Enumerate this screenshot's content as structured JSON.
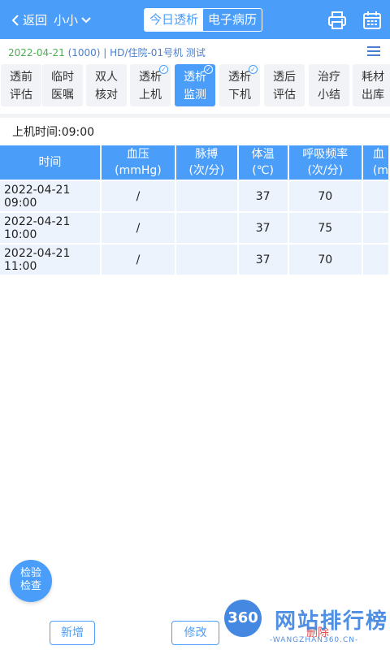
{
  "header": {
    "back_label": "返回",
    "patient_name": "小小",
    "tabs": [
      {
        "label": "今日透析",
        "active": true
      },
      {
        "label": "电子病历",
        "active": false
      }
    ],
    "icons": [
      "printer-icon",
      "calendar-icon"
    ]
  },
  "info": {
    "date": "2022-04-21",
    "rest": " (1000) | HD/住院-01号机 测试"
  },
  "steps": [
    {
      "line1": "透前",
      "line2": "评估",
      "checked": false,
      "active": false
    },
    {
      "line1": "临时",
      "line2": "医嘱",
      "checked": false,
      "active": false
    },
    {
      "line1": "双人",
      "line2": "核对",
      "checked": false,
      "active": false
    },
    {
      "line1": "透析",
      "line2": "上机",
      "checked": true,
      "active": false
    },
    {
      "line1": "透析",
      "line2": "监测",
      "checked": true,
      "active": true
    },
    {
      "line1": "透析",
      "line2": "下机",
      "checked": true,
      "active": false
    },
    {
      "line1": "透后",
      "line2": "评估",
      "checked": false,
      "active": false
    },
    {
      "line1": "治疗",
      "line2": "小结",
      "checked": false,
      "active": false
    },
    {
      "line1": "耗材",
      "line2": "出库",
      "checked": false,
      "active": false
    }
  ],
  "start_time": "上机时间:09:00",
  "table": {
    "headers": [
      {
        "line1": "时间",
        "line2": ""
      },
      {
        "line1": "血压",
        "line2": "(mmHg)"
      },
      {
        "line1": "脉搏",
        "line2": "(次/分)"
      },
      {
        "line1": "体温",
        "line2": "(℃)"
      },
      {
        "line1": "呼吸频率",
        "line2": "(次/分)"
      },
      {
        "line1": "血",
        "line2": "(m"
      }
    ],
    "rows": [
      [
        "2022-04-21 09:00",
        "/",
        "",
        "37",
        "70",
        ""
      ],
      [
        "2022-04-21 10:00",
        "/",
        "",
        "37",
        "75",
        ""
      ],
      [
        "2022-04-21 11:00",
        "/",
        "",
        "37",
        "70",
        ""
      ]
    ]
  },
  "float_button": {
    "line1": "检验",
    "line2": "检查"
  },
  "buttons": {
    "add": "新增",
    "edit": "修改",
    "delete": "删除"
  },
  "watermark": {
    "badge": "360",
    "title": "网站排行榜",
    "sub": "-WANGZHAN360.CN-"
  },
  "colors": {
    "primary": "#4a9df8",
    "date_green": "#4caf50",
    "danger": "#e05050",
    "cell_bg": "#edf3fc"
  }
}
